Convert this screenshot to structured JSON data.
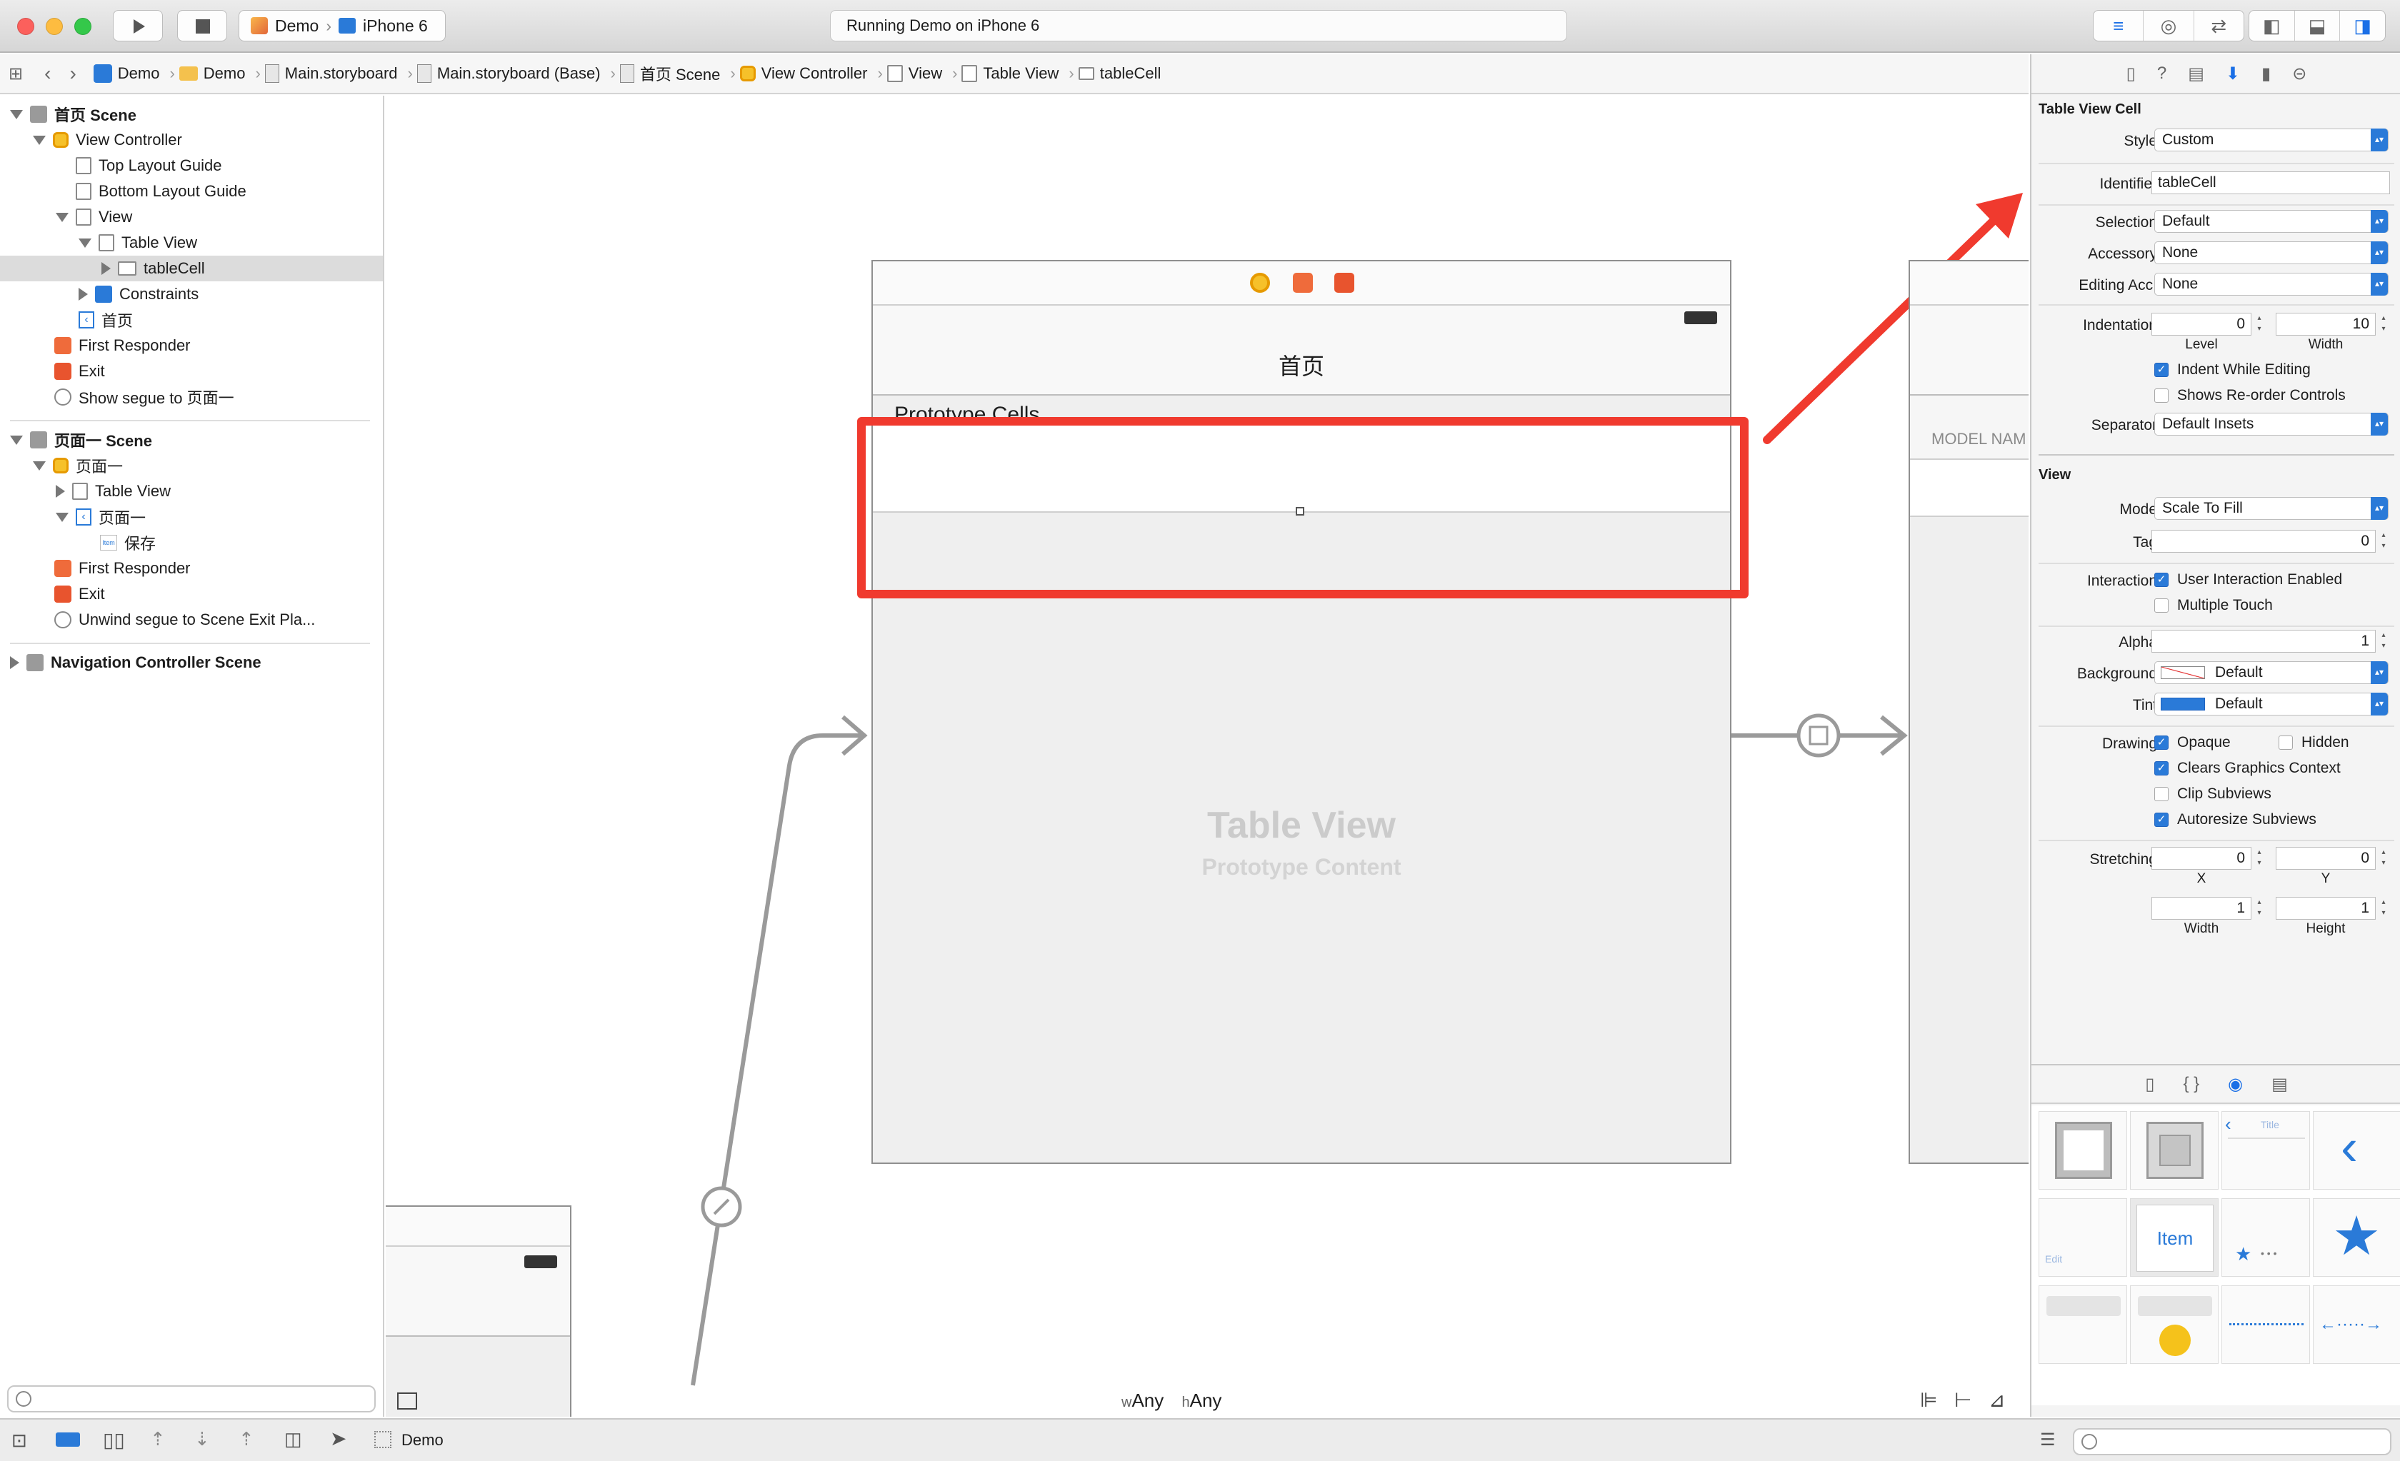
{
  "toolbar": {
    "scheme_app": "Demo",
    "scheme_device": "iPhone 6",
    "status": "Running Demo on iPhone 6"
  },
  "jumpbar": {
    "crumbs": [
      "Demo",
      "Demo",
      "Main.storyboard",
      "Main.storyboard (Base)",
      "首页 Scene",
      "View Controller",
      "View",
      "Table View",
      "tableCell"
    ]
  },
  "navigator": {
    "scene1": {
      "title": "首页 Scene",
      "view_controller": "View Controller",
      "top_layout_guide": "Top Layout Guide",
      "bottom_layout_guide": "Bottom Layout Guide",
      "view": "View",
      "table_view": "Table View",
      "table_cell": "tableCell",
      "constraints": "Constraints",
      "nav_item": "首页",
      "first_responder": "First Responder",
      "exit": "Exit",
      "segue": "Show segue to 页面一"
    },
    "scene2": {
      "title": "页面一 Scene",
      "view_controller": "页面一",
      "table_view": "Table View",
      "nav_item": "页面一",
      "bar_item": "保存",
      "first_responder": "First Responder",
      "exit": "Exit",
      "unwind": "Unwind segue to Scene Exit Pla..."
    },
    "scene3": {
      "title": "Navigation Controller Scene"
    }
  },
  "canvas": {
    "nav_title": "首页",
    "prototype_cells": "Prototype Cells",
    "table_placeholder": "Table View",
    "table_subtitle": "Prototype Content",
    "side_label": "MODEL NAM",
    "size_w_prefix": "w",
    "size_w": "Any",
    "size_h_prefix": "h",
    "size_h": "Any"
  },
  "colors": {
    "annotation": "#f03a2e",
    "accent": "#2a7ad8"
  },
  "inspector": {
    "cell_section": "Table View Cell",
    "style_label": "Style",
    "style_value": "Custom",
    "identifier_label": "Identifier",
    "identifier_value": "tableCell",
    "selection_label": "Selection",
    "selection_value": "Default",
    "accessory_label": "Accessory",
    "accessory_value": "None",
    "editing_label": "Editing Acc.",
    "editing_value": "None",
    "indentation_label": "Indentation",
    "indent_level": "0",
    "indent_width": "10",
    "level_caption": "Level",
    "width_caption": "Width",
    "indent_while_editing": "Indent While Editing",
    "shows_reorder": "Shows Re-order Controls",
    "separator_label": "Separator",
    "separator_value": "Default Insets",
    "view_section": "View",
    "mode_label": "Mode",
    "mode_value": "Scale To Fill",
    "tag_label": "Tag",
    "tag_value": "0",
    "interaction_label": "Interaction",
    "user_interaction": "User Interaction Enabled",
    "multiple_touch": "Multiple Touch",
    "alpha_label": "Alpha",
    "alpha_value": "1",
    "background_label": "Background",
    "background_value": "Default",
    "tint_label": "Tint",
    "tint_value": "Default",
    "drawing_label": "Drawing",
    "opaque": "Opaque",
    "hidden": "Hidden",
    "clears_graphics": "Clears Graphics Context",
    "clip_subviews": "Clip Subviews",
    "autoresize": "Autoresize Subviews",
    "stretching_label": "Stretching",
    "stretch_x": "0",
    "stretch_y": "0",
    "stretch_w": "1",
    "stretch_h": "1",
    "x_caption": "X",
    "y_caption": "Y",
    "w_caption": "Width",
    "h_caption": "Height"
  },
  "library": {
    "nav_item_title": "Title",
    "edit_label": "Edit",
    "item_label": "Item",
    "dots": "• • •"
  },
  "bottombar": {
    "target": "Demo"
  }
}
